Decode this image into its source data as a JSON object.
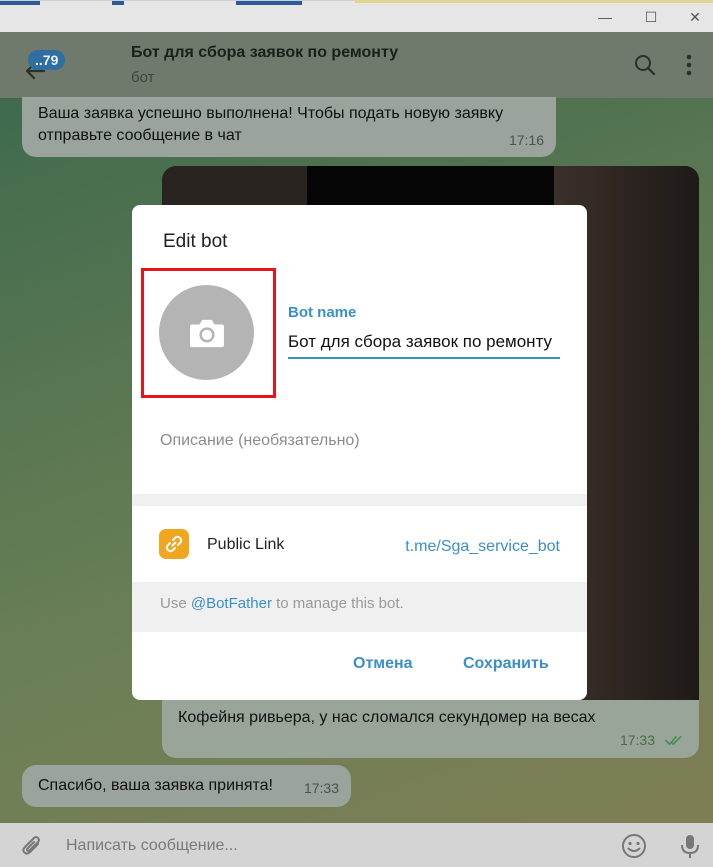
{
  "window": {
    "minimize": "—",
    "maximize": "☐",
    "close": "✕"
  },
  "header": {
    "unread_count": "..79",
    "title": "Бот для сбора заявок по ремонту",
    "subtitle": "бот"
  },
  "messages": {
    "first_text": "Ваша заявка успешно выполнена! Чтобы подать новую заявку отправьте сообщение в чат",
    "first_time": "17:16",
    "outgoing_text": "Кофейня ривьера, у нас сломался секундомер на весах",
    "outgoing_time": "17:33",
    "last_text": "Спасибо, ваша заявка принята!",
    "last_time": "17:33"
  },
  "dialog": {
    "title": "Edit bot",
    "bot_name_label": "Bot name",
    "bot_name_value": "Бот для сбора заявок по ремонту",
    "description_placeholder": "Описание (необязательно)",
    "public_link_label": "Public Link",
    "public_link_value": "t.me/Sga_service_bot",
    "hint_prefix": "Use ",
    "hint_mention": "@BotFather",
    "hint_suffix": " to manage this bot.",
    "cancel_label": "Отмена",
    "save_label": "Сохранить"
  },
  "composer": {
    "placeholder": "Написать сообщение..."
  },
  "colors": {
    "accent": "#3a8fc9",
    "highlight": "#e8141b",
    "link_icon": "#f0a61e"
  }
}
